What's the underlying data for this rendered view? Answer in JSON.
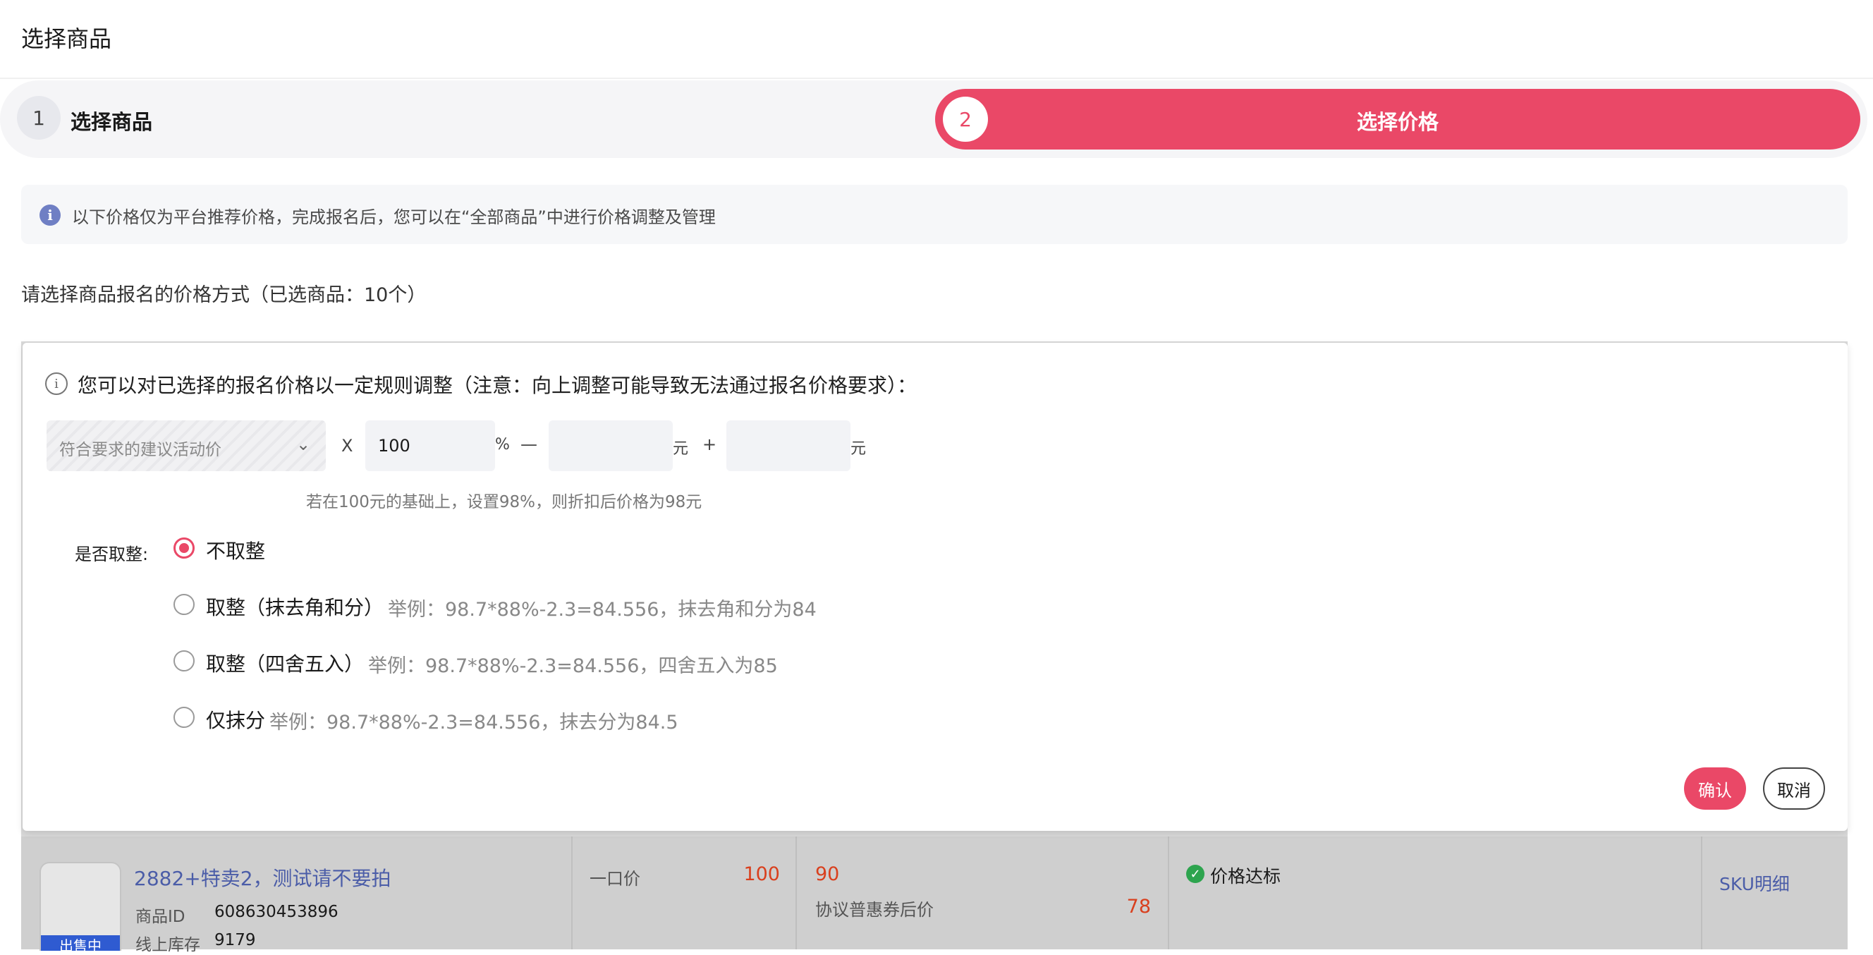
{
  "page": {
    "title": "选择商品"
  },
  "steps": [
    {
      "number": "1",
      "label": "选择商品"
    },
    {
      "number": "2",
      "label": "选择价格"
    }
  ],
  "notice": {
    "icon": "info-icon",
    "text": "以下价格仅为平台推荐价格，完成报名后，您可以在“全部商品”中进行价格调整及管理"
  },
  "question": "请选择商品报名的价格方式（已选商品：10个）",
  "panel": {
    "title": "您可以对已选择的报名价格以一定规则调整（注意：向上调整可能导致无法通过报名价格要求）：",
    "formula": {
      "base_select_placeholder": "符合要求的建议活动价",
      "times": "X",
      "percent_value": "100",
      "percent_unit": "%",
      "minus": "—",
      "minus_value": "",
      "yuan": "元",
      "plus": "+",
      "plus_value": ""
    },
    "hint": "若在100元的基础上，设置98%，则折扣后价格为98元",
    "rounding": {
      "label": "是否取整:",
      "selected_index": 0,
      "options": [
        {
          "label": "不取整",
          "example": ""
        },
        {
          "label": "取整（抹去角和分）",
          "example": "举例：98.7*88%-2.3=84.556，抹去角和分为84"
        },
        {
          "label": "取整（四舍五入）",
          "example": "举例：98.7*88%-2.3=84.556，四舍五入为85"
        },
        {
          "label": "仅抹分",
          "example": "举例：98.7*88%-2.3=84.556，抹去分为84.5"
        }
      ]
    },
    "confirm_label": "确认",
    "cancel_label": "取消"
  },
  "product_row": {
    "status_badge": "出售中",
    "name": "2882+特卖2，测试请不要拍",
    "id_label": "商品ID",
    "id_value": "608630453896",
    "stock_label": "线上库存",
    "stock_value": "9179",
    "price_type": "一口价",
    "price_value": "100",
    "agreement_price": "90",
    "agreement_label": "协议普惠券后价",
    "agreement_after_value": "78",
    "status_text": "价格达标",
    "sku_link": "SKU明细"
  },
  "colors": {
    "accent": "#ea4867",
    "link": "#4b5da8",
    "price_red": "#d9401e",
    "success_green": "#2da44e"
  }
}
